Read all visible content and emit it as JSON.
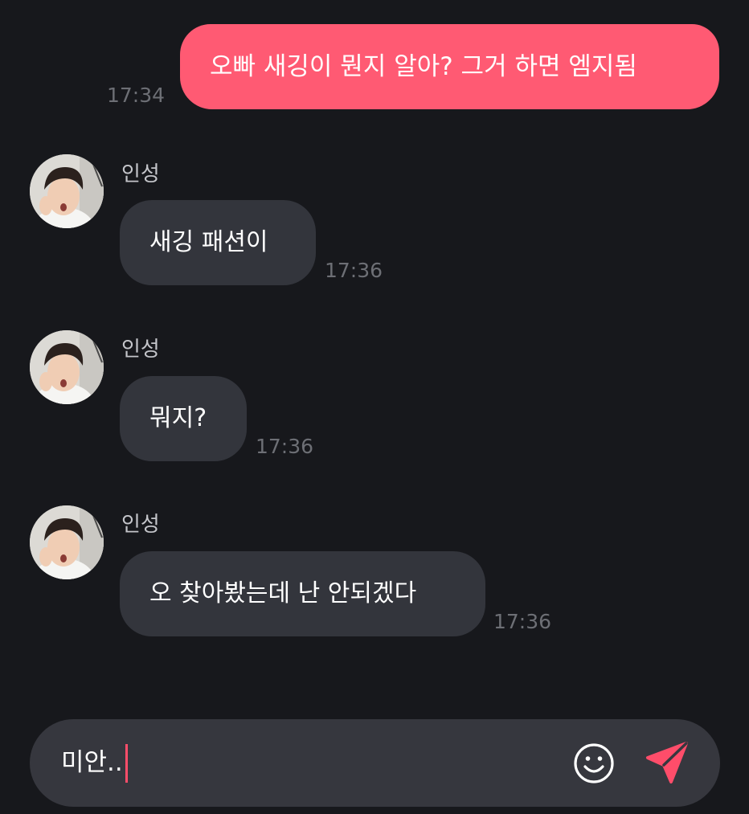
{
  "outgoing": {
    "text": "오빠 새깅이 뭔지 알아? 그거 하면 엠지됨",
    "time": "17:34",
    "color": "#ff5a73"
  },
  "incoming": [
    {
      "sender": "인성",
      "text": "새깅 패션이",
      "time": "17:36"
    },
    {
      "sender": "인성",
      "text": "뭐지?",
      "time": "17:36"
    },
    {
      "sender": "인성",
      "text": "오 찾아봤는데 난 안되겠다",
      "time": "17:36"
    }
  ],
  "composer": {
    "value": "미안..",
    "emoji_icon": "smiley-icon",
    "send_icon": "paper-plane-send-icon",
    "accent": "#ff4d6a"
  }
}
